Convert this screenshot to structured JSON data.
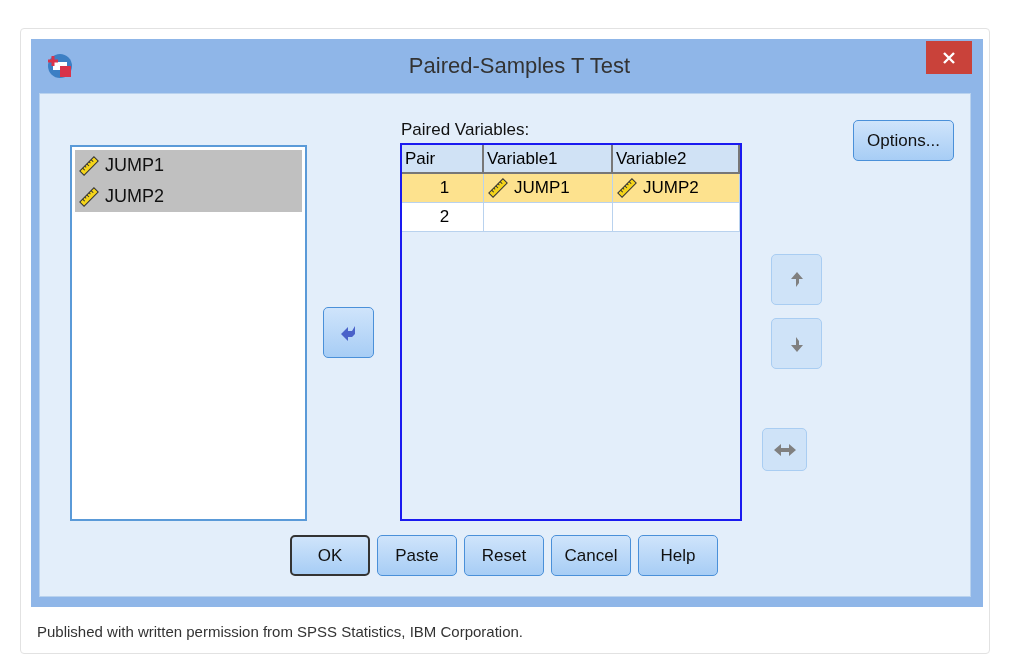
{
  "window": {
    "title": "Paired-Samples T Test"
  },
  "source_list": {
    "items": [
      {
        "name": "JUMP1",
        "selected": true
      },
      {
        "name": "JUMP2",
        "selected": true
      }
    ]
  },
  "move_button": {
    "disabled": false
  },
  "paired_variables": {
    "label": "Paired Variables:",
    "columns": [
      "Pair",
      "Variable1",
      "Variable2"
    ],
    "rows": [
      {
        "cells": [
          "1",
          "JUMP1",
          "JUMP2"
        ],
        "selected": true
      },
      {
        "cells": [
          "2"
        ],
        "selected": false
      }
    ]
  },
  "side_buttons": [
    {
      "kind": "up",
      "disabled": true
    },
    {
      "kind": "down",
      "disabled": true
    },
    {
      "kind": "swap",
      "disabled": true
    }
  ],
  "options_button": {
    "label": "Options..."
  },
  "buttons": [
    {
      "label": "OK",
      "default": true
    },
    {
      "label": "Paste",
      "default": false
    },
    {
      "label": "Reset",
      "default": false
    },
    {
      "label": "Cancel",
      "default": false
    },
    {
      "label": "Help",
      "default": false
    }
  ],
  "caption": "Published with written permission from SPSS Statistics, IBM Corporation."
}
